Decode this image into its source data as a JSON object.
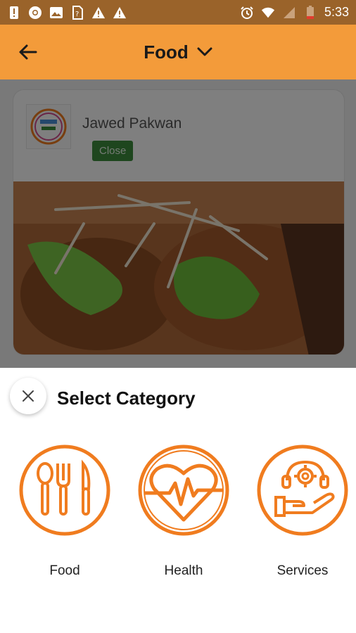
{
  "status_bar": {
    "time": "5:33",
    "left_icons": [
      "alert-icon",
      "chrome-icon",
      "image-icon",
      "sim-icon",
      "warning-icon",
      "warning-icon"
    ],
    "right_icons": [
      "alarm-icon",
      "wifi-icon",
      "signal-icon",
      "battery-icon"
    ]
  },
  "app_bar": {
    "title": "Food",
    "accent_color": "#f39b3a"
  },
  "store": {
    "name": "Jawed Pakwan",
    "status": "Close",
    "status_color": "#3c8d3c"
  },
  "sheet": {
    "title": "Select Category",
    "categories": [
      {
        "label": "Food",
        "icon": "utensils-icon"
      },
      {
        "label": "Health",
        "icon": "heart-pulse-icon"
      },
      {
        "label": "Services",
        "icon": "service-hand-icon"
      }
    ],
    "icon_color": "#f07c1f"
  }
}
